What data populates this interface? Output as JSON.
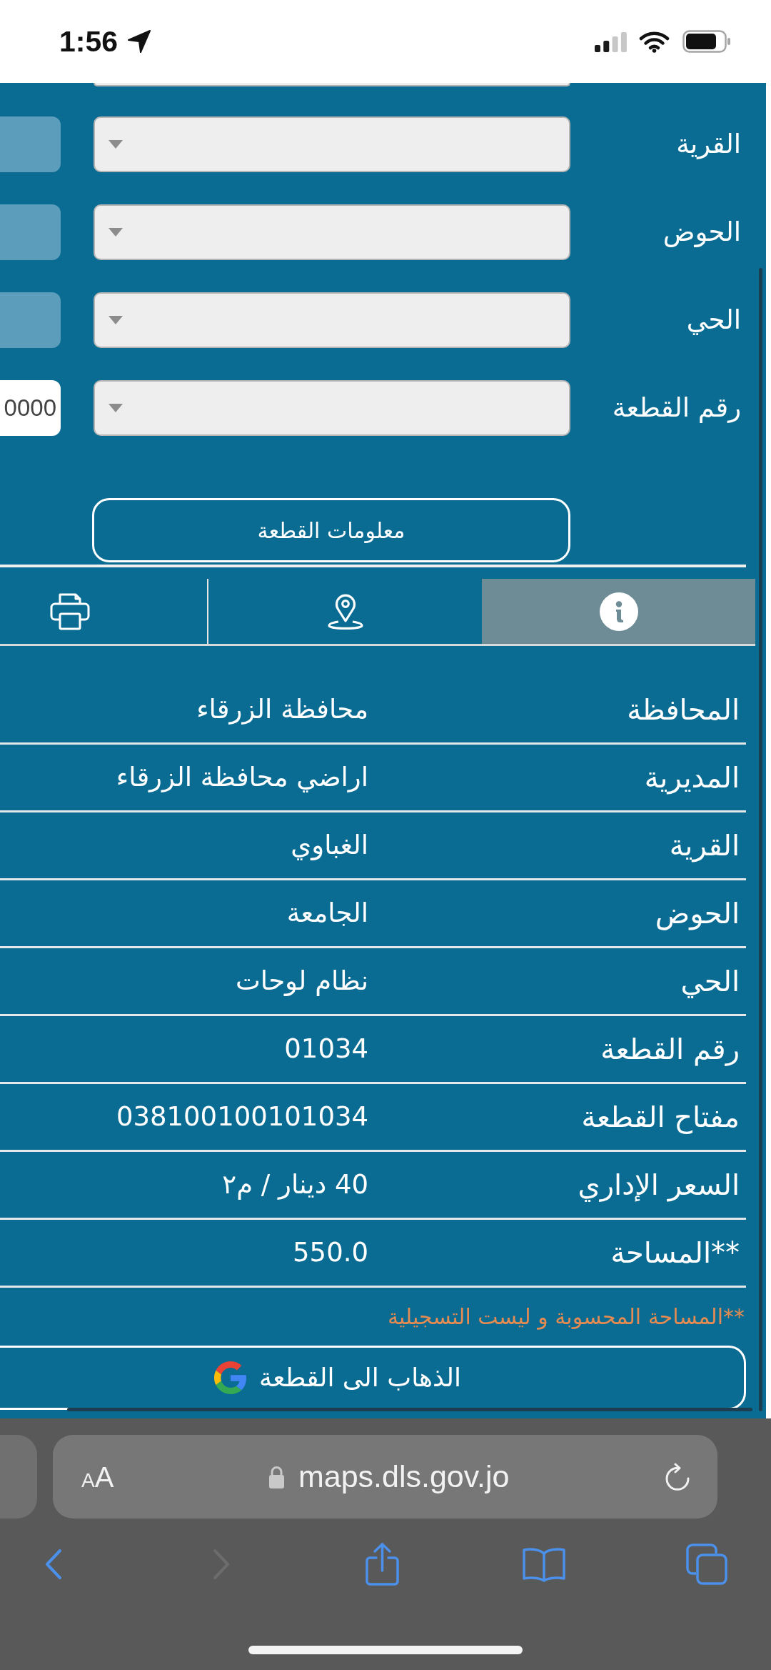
{
  "status_bar": {
    "time": "1:56"
  },
  "form": {
    "fields": [
      {
        "label": "القرية",
        "side_field": {
          "disabled": true
        }
      },
      {
        "label": "الحوض",
        "side_field": {
          "disabled": true
        }
      },
      {
        "label": "الحي",
        "side_field": {
          "disabled": true
        }
      },
      {
        "label": "رقم القطعة",
        "side_field": {
          "disabled": false,
          "value": "0000"
        }
      }
    ],
    "info_button": "معلومات القطعة"
  },
  "tabs": [
    {
      "kind": "info",
      "selected": true
    },
    {
      "kind": "location",
      "selected": false
    },
    {
      "kind": "print",
      "selected": false
    }
  ],
  "details": {
    "rows": [
      {
        "label": "المحافظة",
        "value": "محافظة الزرقاء"
      },
      {
        "label": "المديرية",
        "value": "اراضي محافظة الزرقاء"
      },
      {
        "label": "القرية",
        "value": "الغباوي"
      },
      {
        "label": "الحوض",
        "value": "الجامعة"
      },
      {
        "label": "الحي",
        "value": "نظام لوحات"
      },
      {
        "label": "رقم القطعة",
        "value": "01034"
      },
      {
        "label": "مفتاح القطعة",
        "value": "038100100101034"
      },
      {
        "label": "السعر الإداري",
        "value": "40 دينار / م٢"
      },
      {
        "label": "**المساحة",
        "value": "550.0"
      }
    ],
    "note": "**المساحة المحسوبة و ليست التسجيلية"
  },
  "map_button": {
    "label": "الذهاب الى القطعة"
  },
  "browser": {
    "text_size_button": "AA",
    "url": "maps.dls.gov.jo",
    "toolbar": {
      "back": {
        "disabled": false
      },
      "forward": {
        "disabled": true
      }
    }
  }
}
